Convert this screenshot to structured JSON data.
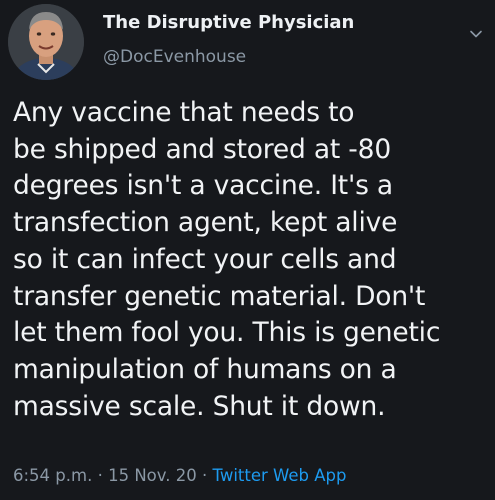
{
  "author": {
    "display_name": "The Disruptive Physician",
    "handle": "@DocEvenhouse",
    "avatar_icon": "profile-photo"
  },
  "tweet": {
    "lines": [
      "Any vaccine that needs to",
      "be shipped and stored at -80",
      "degrees isn't a vaccine. It's a",
      "transfection agent, kept alive",
      "so it can infect your cells and",
      "transfer genetic material. Don't",
      "let them fool you. This is genetic",
      "manipulation of humans on a",
      "massive scale. Shut it down."
    ]
  },
  "meta": {
    "time": "6:54 p.m.",
    "separator": "·",
    "date": "15 Nov. 20",
    "source": "Twitter Web App"
  },
  "menu": {
    "icon": "chevron-down-icon"
  },
  "colors": {
    "background": "#16181c",
    "text": "#f1f3f5",
    "muted": "#8b98a5",
    "link": "#1d9bf0"
  }
}
